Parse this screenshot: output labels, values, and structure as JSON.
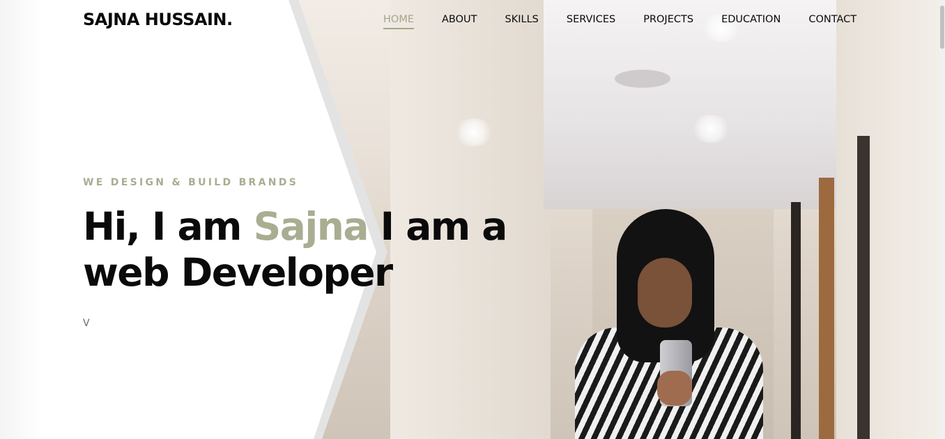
{
  "header": {
    "logo": "SAJNA HUSSAIN."
  },
  "nav": {
    "items": [
      {
        "label": "HOME",
        "active": true
      },
      {
        "label": "ABOUT"
      },
      {
        "label": "SKILLS"
      },
      {
        "label": "SERVICES"
      },
      {
        "label": "PROJECTS"
      },
      {
        "label": "EDUCATION"
      },
      {
        "label": "CONTACT"
      }
    ]
  },
  "hero": {
    "tagline": "WE DESIGN & BUILD BRANDS",
    "headline_prefix": "Hi, I am ",
    "headline_name": "Sajna",
    "headline_suffix": " I am a web Developer",
    "typed_text": "V"
  },
  "colors": {
    "accent": "#a9ad92",
    "text": "#0a0a0a",
    "background": "#ffffff"
  }
}
